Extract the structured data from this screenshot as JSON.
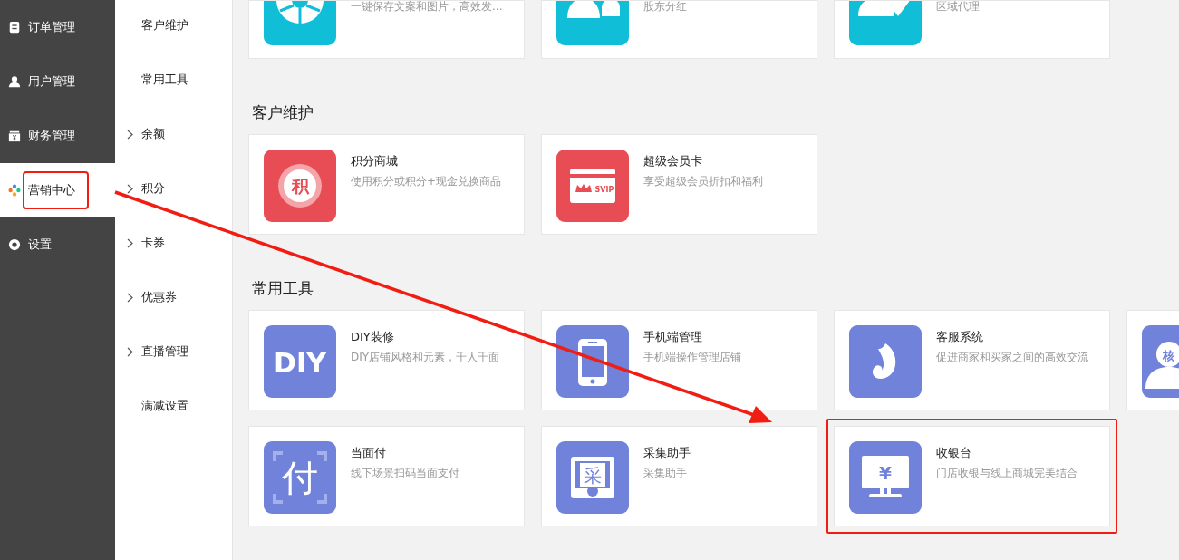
{
  "sidebar": {
    "items": [
      {
        "label": "订单管理",
        "kind": "document",
        "selected": false,
        "highlighted": false
      },
      {
        "label": "用户管理",
        "kind": "person",
        "selected": false,
        "highlighted": false
      },
      {
        "label": "财务管理",
        "kind": "wallet",
        "selected": false,
        "highlighted": false
      },
      {
        "label": "营销中心",
        "kind": "flower",
        "selected": true,
        "highlighted": true
      },
      {
        "label": "设置",
        "kind": "ring",
        "selected": false,
        "highlighted": false
      }
    ]
  },
  "submenu": {
    "items": [
      {
        "label": "客户维护",
        "expandable": false
      },
      {
        "label": "常用工具",
        "expandable": false
      },
      {
        "label": "余额",
        "expandable": true
      },
      {
        "label": "积分",
        "expandable": true
      },
      {
        "label": "卡券",
        "expandable": true
      },
      {
        "label": "优惠券",
        "expandable": true
      },
      {
        "label": "直播管理",
        "expandable": true
      },
      {
        "label": "满减设置",
        "expandable": false
      }
    ]
  },
  "top_cards": [
    {
      "description": "一键保存文案和图片，高效发...",
      "kind": "camera",
      "color": "#10bed8"
    },
    {
      "description": "股东分红",
      "kind": "shareholder",
      "color": "#10bed8"
    },
    {
      "description": "区域代理",
      "kind": "agent",
      "color": "#10bed8"
    }
  ],
  "sections": [
    {
      "heading": "客户维护",
      "cards": [
        {
          "title": "积分商城",
          "description": "使用积分或积分+现金兑换商品",
          "kind": "points",
          "icon_text": "积",
          "color": "#e84c55",
          "highlighted": false
        },
        {
          "title": "超级会员卡",
          "description": "享受超级会员折扣和福利",
          "kind": "card",
          "icon_text": "SVIP",
          "color": "#e84c55",
          "highlighted": false
        }
      ]
    },
    {
      "heading": "常用工具",
      "cards": [
        {
          "title": "DIY装修",
          "description": "DIY店铺风格和元素，千人千面",
          "kind": "text",
          "icon_text": "DIY",
          "color": "#7082d9",
          "highlighted": false
        },
        {
          "title": "手机端管理",
          "description": "手机端操作管理店铺",
          "kind": "phone",
          "color": "#7082d9",
          "highlighted": false
        },
        {
          "title": "客服系统",
          "description": "促进商家和买家之间的高效交流",
          "kind": "swirl",
          "color": "#7082d9",
          "highlighted": false
        },
        {
          "kind": "verify",
          "icon_text": "核",
          "color": "#7082d9",
          "highlighted": false
        },
        {
          "title": "当面付",
          "description": "线下场景扫码当面支付",
          "kind": "scan",
          "icon_text": "付",
          "color": "#7082d9",
          "highlighted": false
        },
        {
          "title": "采集助手",
          "description": "采集助手",
          "kind": "collect",
          "icon_text": "采",
          "color": "#7082d9",
          "highlighted": false
        },
        {
          "title": "收银台",
          "description": "门店收银与线上商城完美结合",
          "kind": "monitor",
          "icon_text": "¥",
          "color": "#7082d9",
          "highlighted": true
        }
      ]
    }
  ],
  "annotations": [
    {
      "kind": "arrow"
    }
  ]
}
